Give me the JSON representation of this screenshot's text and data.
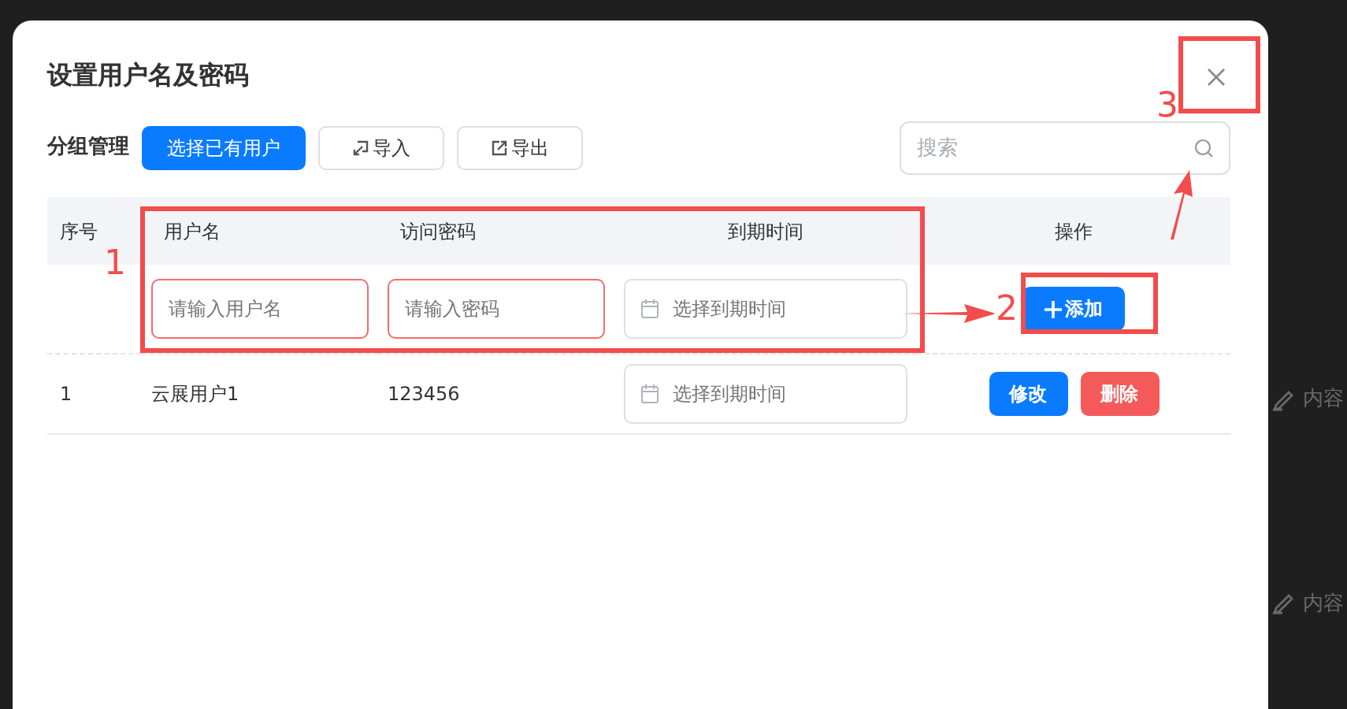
{
  "dialog": {
    "title": "设置用户名及密码"
  },
  "toolbar": {
    "label": "分组管理",
    "buttons": [
      {
        "label": "选择已有用户",
        "kind": "primary"
      },
      {
        "label": "导入",
        "kind": "import"
      },
      {
        "label": "导出",
        "kind": "export"
      }
    ]
  },
  "search": {
    "placeholder": "搜索"
  },
  "table": {
    "columns": [
      "序号",
      "用户名",
      "访问密码",
      "到期时间",
      "操作"
    ],
    "new_row": {
      "fields": [
        {
          "kind": "text",
          "placeholder": "请输入用户名",
          "error": true
        },
        {
          "kind": "text",
          "placeholder": "请输入密码",
          "error": true
        },
        {
          "kind": "date",
          "placeholder": "选择到期时间",
          "error": false
        }
      ],
      "add_button": "添加"
    },
    "rows": [
      {
        "index": "1",
        "username": "云展用户1",
        "password": "123456",
        "date_placeholder": "选择到期时间",
        "actions": [
          {
            "label": "修改",
            "kind": "edit"
          },
          {
            "label": "删除",
            "kind": "delete"
          }
        ]
      }
    ]
  },
  "annotations": [
    {
      "label": "1"
    },
    {
      "label": "2"
    },
    {
      "label": "3"
    }
  ],
  "background": {
    "items": [
      {
        "text": "内容"
      },
      {
        "text": "内容"
      }
    ]
  }
}
